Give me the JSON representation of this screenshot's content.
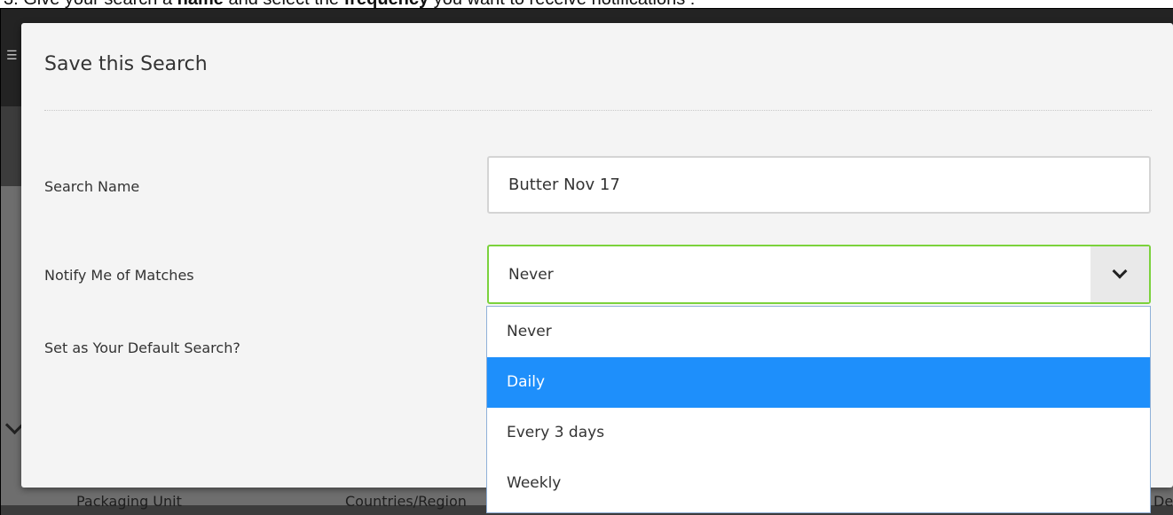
{
  "instruction": {
    "prefix": "3. Give your search a ",
    "bold1": "name",
    "middle": " and select the ",
    "bold2": "frequency",
    "suffix": " you want to receive notifications :"
  },
  "background": {
    "menu_glyph": "☰",
    "columns": [
      "Packaging Unit",
      "Countries/Region",
      "De"
    ]
  },
  "modal": {
    "title": "Save this Search",
    "fields": {
      "search_name": {
        "label": "Search Name",
        "value": "Butter Nov 17"
      },
      "notify": {
        "label": "Notify Me of Matches",
        "value": "Never"
      },
      "default_search": {
        "label": "Set as Your Default Search?"
      }
    },
    "dropdown": {
      "options": [
        "Never",
        "Daily",
        "Every 3 days",
        "Weekly"
      ],
      "highlighted": "Daily"
    }
  },
  "colors": {
    "accent_focus": "#7bd23c",
    "highlight": "#1e8ffb",
    "backdrop": "#3c3c3c"
  }
}
